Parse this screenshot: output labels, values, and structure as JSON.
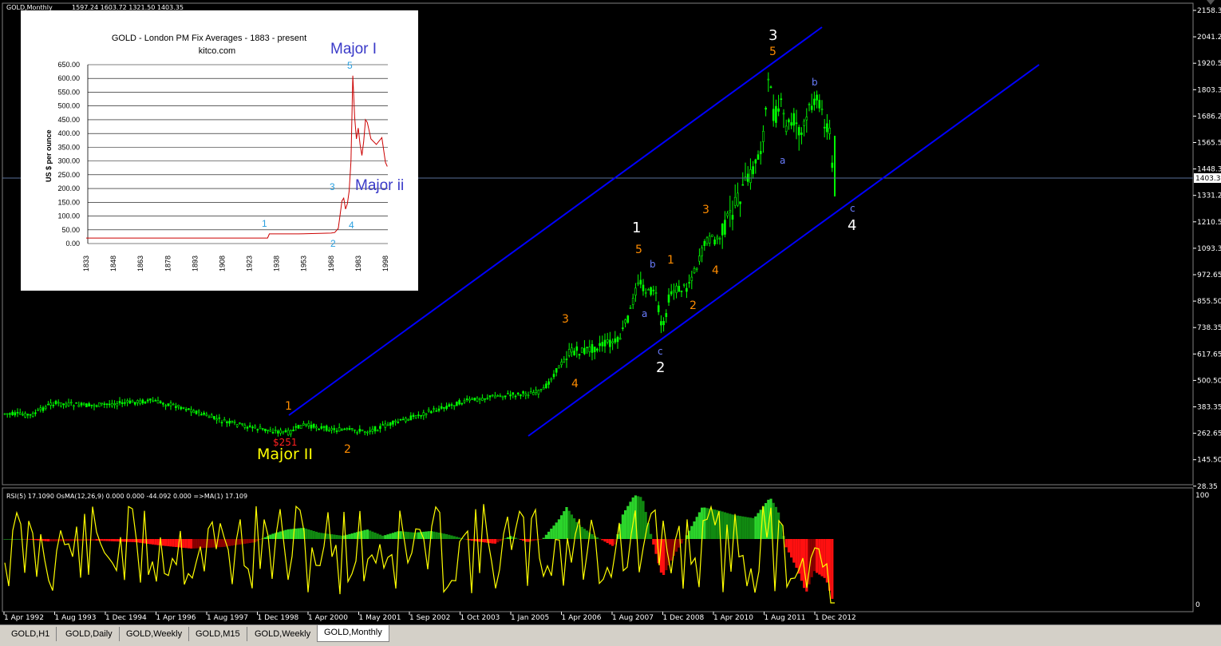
{
  "window": {
    "title": "GOLD,Monthly",
    "ohlc": "1597.24 1603.72 1321.50 1403.35"
  },
  "price_axis": {
    "ticks": [
      "2158.35",
      "2041.20",
      "1920.55",
      "1803.35",
      "1686.20",
      "1565.55",
      "1448.35",
      "1331.20",
      "1210.55",
      "1093.35",
      "972.65",
      "855.50",
      "738.35",
      "617.65",
      "500.50",
      "383.35",
      "262.65",
      "145.50",
      "28.35"
    ],
    "current": "1403.35"
  },
  "date_axis": {
    "labels": [
      "1 Apr 1992",
      "1 Aug 1993",
      "1 Dec 1994",
      "1 Apr 1996",
      "1 Aug 1997",
      "1 Dec 1998",
      "1 Apr 2000",
      "1 May 2001",
      "1 Sep 2002",
      "1 Oct 2003",
      "1 Jan 2005",
      "1 Apr 2006",
      "1 Aug 2007",
      "1 Dec 2008",
      "1 Apr 2010",
      "1 Aug 2011",
      "1 Dec 2012"
    ]
  },
  "indicator": {
    "label": "RSI(5) 17.1090  OsMA(12,26,9) 0.000 0.000 -44.092 0.000  =>MA(1) 17.109",
    "scale_top": "100",
    "scale_bottom": "0"
  },
  "wave_labels": {
    "w1_white": "1",
    "w2_white": "2",
    "w3_white": "3",
    "w4_white": "4",
    "o1_a": "1",
    "o2_a": "2",
    "o3_a": "3",
    "o4_a": "4",
    "o5_a": "5",
    "o1_b": "1",
    "o2_b": "2",
    "o3_b": "3",
    "o4_b": "4",
    "o5_b": "5",
    "a1": "a",
    "b1": "b",
    "c1": "c",
    "a2": "a",
    "b2": "b",
    "c2": "c",
    "low_price": "$251",
    "major_ii": "Major II"
  },
  "inset_chart": {
    "title": "GOLD  -  London PM Fix Averages  -  1883 - present",
    "source": "kitco.com",
    "ylabel": "US $ per ounce",
    "y_ticks": [
      "650.00",
      "600.00",
      "550.00",
      "500.00",
      "450.00",
      "400.00",
      "350.00",
      "300.00",
      "250.00",
      "200.00",
      "150.00",
      "100.00",
      "50.00",
      "0.00"
    ],
    "x_ticks": [
      "1833",
      "1848",
      "1863",
      "1878",
      "1893",
      "1908",
      "1923",
      "1938",
      "1953",
      "1968",
      "1983",
      "1998"
    ],
    "major_i": "Major I",
    "major_ii": "Major ii",
    "wave_1": "1",
    "wave_2": "2",
    "wave_3": "3",
    "wave_4": "4",
    "wave_5": "5"
  },
  "chart_data": {
    "type": "line",
    "title": "GOLD  -  London PM Fix Averages  -  1883 - present",
    "ylabel": "US $ per ounce",
    "ylim": [
      0,
      650
    ],
    "x": [
      1833,
      1900,
      1933,
      1934,
      1950,
      1968,
      1970,
      1972,
      1974,
      1975,
      1976,
      1977,
      1978,
      1979,
      1980,
      1981,
      1982,
      1983,
      1984,
      1985,
      1986,
      1987,
      1988,
      1990,
      1993,
      1996,
      1998,
      1999
    ],
    "values": [
      20,
      20,
      20,
      35,
      35,
      38,
      40,
      55,
      155,
      165,
      125,
      145,
      190,
      300,
      610,
      460,
      380,
      420,
      360,
      320,
      370,
      450,
      440,
      380,
      360,
      385,
      295,
      280
    ]
  },
  "tabs": [
    "GOLD,H1",
    "GOLD,Daily",
    "GOLD,Weekly",
    "GOLD,M15",
    "GOLD,Weekly",
    "GOLD,Monthly"
  ],
  "active_tab": "GOLD,Monthly",
  "colors": {
    "background": "#000000",
    "candles": "#00ff00",
    "channel": "#0000ff",
    "rsi": "#ffff00",
    "osma_pos": "#00c000",
    "osma_neg": "#ff0000",
    "wave_orange": "#ff8c00",
    "wave_white": "#ffffff",
    "wave_abc": "#6a7dff"
  }
}
